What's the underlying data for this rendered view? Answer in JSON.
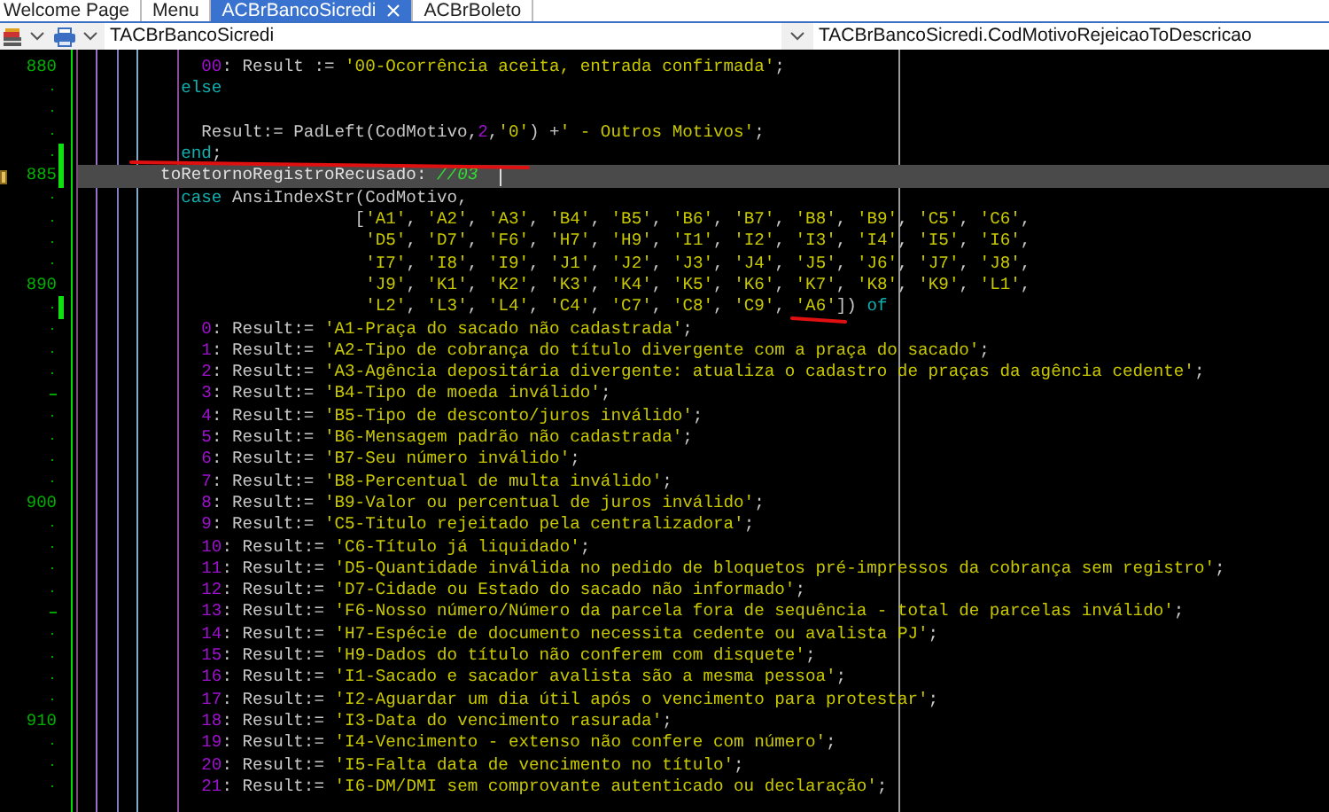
{
  "tabs": [
    {
      "label": "Welcome Page",
      "selected": false,
      "closable": false
    },
    {
      "label": "Menu",
      "selected": false,
      "closable": false
    },
    {
      "label": "ACBrBancoSicredi",
      "selected": true,
      "closable": true
    },
    {
      "label": "ACBrBoleto",
      "selected": false,
      "closable": false
    }
  ],
  "toolbar": {
    "class_combo": {
      "value": "TACBrBancoSicredi"
    },
    "method_combo": {
      "value": "TACBrBancoSicredi.CodMotivoRejeicaoToDescricao"
    }
  },
  "editor": {
    "lines": [
      {
        "number": "880",
        "modified": false,
        "current": false,
        "bookmark": false,
        "tokens": [
          {
            "kind": "num",
            "text": "      00"
          },
          {
            "kind": "id",
            "text": ": Result := "
          },
          {
            "kind": "str",
            "text": "'00-Ocorrência aceita, entrada confirmada'"
          },
          {
            "kind": "id",
            "text": ";"
          }
        ]
      },
      {
        "modified": false,
        "current": false,
        "bookmark": false,
        "tokens": [
          {
            "kind": "kw",
            "text": "    else"
          }
        ]
      },
      {
        "modified": false,
        "current": false,
        "bookmark": false
      },
      {
        "modified": false,
        "current": false,
        "bookmark": false,
        "tokens": [
          {
            "kind": "id",
            "text": "      Result:= PadLeft(CodMotivo,"
          },
          {
            "kind": "num",
            "text": "2"
          },
          {
            "kind": "id",
            "text": ","
          },
          {
            "kind": "str",
            "text": "'0'"
          },
          {
            "kind": "id",
            "text": ") +"
          },
          {
            "kind": "str",
            "text": "' - Outros Motivos'"
          },
          {
            "kind": "id",
            "text": ";"
          }
        ]
      },
      {
        "modified": true,
        "current": false,
        "bookmark": false,
        "tokens": [
          {
            "kind": "kw",
            "text": "    end"
          },
          {
            "kind": "id",
            "text": ";"
          }
        ]
      },
      {
        "number": "885",
        "modified": true,
        "current": true,
        "bookmark": true,
        "tokens": [
          {
            "kind": "id",
            "text": "  toRetornoRegistroRecusado: "
          },
          {
            "kind": "comment",
            "text": "//03"
          }
        ]
      },
      {
        "modified": false,
        "current": false,
        "bookmark": false,
        "tokens": [
          {
            "kind": "kw",
            "text": "    case"
          },
          {
            "kind": "id",
            "text": " AnsiIndexStr(CodMotivo,"
          }
        ]
      },
      {
        "modified": false,
        "current": false,
        "bookmark": false,
        "tokens": [
          {
            "kind": "id",
            "text": "                     ["
          },
          {
            "kind": "str",
            "text": "'A1'"
          },
          {
            "kind": "id",
            "text": ", "
          },
          {
            "kind": "str",
            "text": "'A2'"
          },
          {
            "kind": "id",
            "text": ", "
          },
          {
            "kind": "str",
            "text": "'A3'"
          },
          {
            "kind": "id",
            "text": ", "
          },
          {
            "kind": "str",
            "text": "'B4'"
          },
          {
            "kind": "id",
            "text": ", "
          },
          {
            "kind": "str",
            "text": "'B5'"
          },
          {
            "kind": "id",
            "text": ", "
          },
          {
            "kind": "str",
            "text": "'B6'"
          },
          {
            "kind": "id",
            "text": ", "
          },
          {
            "kind": "str",
            "text": "'B7'"
          },
          {
            "kind": "id",
            "text": ", "
          },
          {
            "kind": "str",
            "text": "'B8'"
          },
          {
            "kind": "id",
            "text": ", "
          },
          {
            "kind": "str",
            "text": "'B9'"
          },
          {
            "kind": "id",
            "text": ", "
          },
          {
            "kind": "str",
            "text": "'C5'"
          },
          {
            "kind": "id",
            "text": ", "
          },
          {
            "kind": "str",
            "text": "'C6'"
          },
          {
            "kind": "id",
            "text": ","
          }
        ]
      },
      {
        "modified": false,
        "current": false,
        "bookmark": false,
        "tokens": [
          {
            "kind": "str",
            "text": "                      'D5'"
          },
          {
            "kind": "id",
            "text": ", "
          },
          {
            "kind": "str",
            "text": "'D7'"
          },
          {
            "kind": "id",
            "text": ", "
          },
          {
            "kind": "str",
            "text": "'F6'"
          },
          {
            "kind": "id",
            "text": ", "
          },
          {
            "kind": "str",
            "text": "'H7'"
          },
          {
            "kind": "id",
            "text": ", "
          },
          {
            "kind": "str",
            "text": "'H9'"
          },
          {
            "kind": "id",
            "text": ", "
          },
          {
            "kind": "str",
            "text": "'I1'"
          },
          {
            "kind": "id",
            "text": ", "
          },
          {
            "kind": "str",
            "text": "'I2'"
          },
          {
            "kind": "id",
            "text": ", "
          },
          {
            "kind": "str",
            "text": "'I3'"
          },
          {
            "kind": "id",
            "text": ", "
          },
          {
            "kind": "str",
            "text": "'I4'"
          },
          {
            "kind": "id",
            "text": ", "
          },
          {
            "kind": "str",
            "text": "'I5'"
          },
          {
            "kind": "id",
            "text": ", "
          },
          {
            "kind": "str",
            "text": "'I6'"
          },
          {
            "kind": "id",
            "text": ","
          }
        ]
      },
      {
        "modified": false,
        "current": false,
        "bookmark": false,
        "tokens": [
          {
            "kind": "str",
            "text": "                      'I7'"
          },
          {
            "kind": "id",
            "text": ", "
          },
          {
            "kind": "str",
            "text": "'I8'"
          },
          {
            "kind": "id",
            "text": ", "
          },
          {
            "kind": "str",
            "text": "'I9'"
          },
          {
            "kind": "id",
            "text": ", "
          },
          {
            "kind": "str",
            "text": "'J1'"
          },
          {
            "kind": "id",
            "text": ", "
          },
          {
            "kind": "str",
            "text": "'J2'"
          },
          {
            "kind": "id",
            "text": ", "
          },
          {
            "kind": "str",
            "text": "'J3'"
          },
          {
            "kind": "id",
            "text": ", "
          },
          {
            "kind": "str",
            "text": "'J4'"
          },
          {
            "kind": "id",
            "text": ", "
          },
          {
            "kind": "str",
            "text": "'J5'"
          },
          {
            "kind": "id",
            "text": ", "
          },
          {
            "kind": "str",
            "text": "'J6'"
          },
          {
            "kind": "id",
            "text": ", "
          },
          {
            "kind": "str",
            "text": "'J7'"
          },
          {
            "kind": "id",
            "text": ", "
          },
          {
            "kind": "str",
            "text": "'J8'"
          },
          {
            "kind": "id",
            "text": ","
          }
        ]
      },
      {
        "number": "890",
        "modified": false,
        "current": false,
        "bookmark": false,
        "tokens": [
          {
            "kind": "str",
            "text": "                      'J9'"
          },
          {
            "kind": "id",
            "text": ", "
          },
          {
            "kind": "str",
            "text": "'K1'"
          },
          {
            "kind": "id",
            "text": ", "
          },
          {
            "kind": "str",
            "text": "'K2'"
          },
          {
            "kind": "id",
            "text": ", "
          },
          {
            "kind": "str",
            "text": "'K3'"
          },
          {
            "kind": "id",
            "text": ", "
          },
          {
            "kind": "str",
            "text": "'K4'"
          },
          {
            "kind": "id",
            "text": ", "
          },
          {
            "kind": "str",
            "text": "'K5'"
          },
          {
            "kind": "id",
            "text": ", "
          },
          {
            "kind": "str",
            "text": "'K6'"
          },
          {
            "kind": "id",
            "text": ", "
          },
          {
            "kind": "str",
            "text": "'K7'"
          },
          {
            "kind": "id",
            "text": ", "
          },
          {
            "kind": "str",
            "text": "'K8'"
          },
          {
            "kind": "id",
            "text": ", "
          },
          {
            "kind": "str",
            "text": "'K9'"
          },
          {
            "kind": "id",
            "text": ", "
          },
          {
            "kind": "str",
            "text": "'L1'"
          },
          {
            "kind": "id",
            "text": ","
          }
        ]
      },
      {
        "modified": true,
        "current": false,
        "bookmark": false,
        "tokens": [
          {
            "kind": "str",
            "text": "                      'L2'"
          },
          {
            "kind": "id",
            "text": ", "
          },
          {
            "kind": "str",
            "text": "'L3'"
          },
          {
            "kind": "id",
            "text": ", "
          },
          {
            "kind": "str",
            "text": "'L4'"
          },
          {
            "kind": "id",
            "text": ", "
          },
          {
            "kind": "str",
            "text": "'C4'"
          },
          {
            "kind": "id",
            "text": ", "
          },
          {
            "kind": "str",
            "text": "'C7'"
          },
          {
            "kind": "id",
            "text": ", "
          },
          {
            "kind": "str",
            "text": "'C8'"
          },
          {
            "kind": "id",
            "text": ", "
          },
          {
            "kind": "str",
            "text": "'C9'"
          },
          {
            "kind": "id",
            "text": ", "
          },
          {
            "kind": "str",
            "text": "'A6'"
          },
          {
            "kind": "id",
            "text": "])"
          },
          {
            "kind": "kw",
            "text": " of"
          }
        ]
      },
      {
        "modified": false,
        "current": false,
        "bookmark": false,
        "tokens": [
          {
            "kind": "num",
            "text": "      0"
          },
          {
            "kind": "id",
            "text": ": Result:= "
          },
          {
            "kind": "str",
            "text": "'A1-Praça do sacado não cadastrada'"
          },
          {
            "kind": "id",
            "text": ";"
          }
        ]
      },
      {
        "modified": false,
        "current": false,
        "bookmark": false,
        "tokens": [
          {
            "kind": "num",
            "text": "      1"
          },
          {
            "kind": "id",
            "text": ": Result:= "
          },
          {
            "kind": "str",
            "text": "'A2-Tipo de cobrança do título divergente com a praça do sacado'"
          },
          {
            "kind": "id",
            "text": ";"
          }
        ]
      },
      {
        "modified": false,
        "current": false,
        "bookmark": false,
        "tokens": [
          {
            "kind": "num",
            "text": "      2"
          },
          {
            "kind": "id",
            "text": ": Result:= "
          },
          {
            "kind": "str",
            "text": "'A3-Agência depositária divergente: atualiza o cadastro de praças da agência cedente'"
          },
          {
            "kind": "id",
            "text": ";"
          }
        ]
      },
      {
        "modified": false,
        "current": false,
        "bookmark": false,
        "tokens": [
          {
            "kind": "num",
            "text": "      3"
          },
          {
            "kind": "id",
            "text": ": Result:= "
          },
          {
            "kind": "str",
            "text": "'B4-Tipo de moeda inválido'"
          },
          {
            "kind": "id",
            "text": ";"
          }
        ]
      },
      {
        "modified": false,
        "current": false,
        "bookmark": false,
        "tokens": [
          {
            "kind": "num",
            "text": "      4"
          },
          {
            "kind": "id",
            "text": ": Result:= "
          },
          {
            "kind": "str",
            "text": "'B5-Tipo de desconto/juros inválido'"
          },
          {
            "kind": "id",
            "text": ";"
          }
        ]
      },
      {
        "modified": false,
        "current": false,
        "bookmark": false,
        "tokens": [
          {
            "kind": "num",
            "text": "      5"
          },
          {
            "kind": "id",
            "text": ": Result:= "
          },
          {
            "kind": "str",
            "text": "'B6-Mensagem padrão não cadastrada'"
          },
          {
            "kind": "id",
            "text": ";"
          }
        ]
      },
      {
        "modified": false,
        "current": false,
        "bookmark": false,
        "tokens": [
          {
            "kind": "num",
            "text": "      6"
          },
          {
            "kind": "id",
            "text": ": Result:= "
          },
          {
            "kind": "str",
            "text": "'B7-Seu número inválido'"
          },
          {
            "kind": "id",
            "text": ";"
          }
        ]
      },
      {
        "modified": false,
        "current": false,
        "bookmark": false,
        "tokens": [
          {
            "kind": "num",
            "text": "      7"
          },
          {
            "kind": "id",
            "text": ": Result:= "
          },
          {
            "kind": "str",
            "text": "'B8-Percentual de multa inválido'"
          },
          {
            "kind": "id",
            "text": ";"
          }
        ]
      },
      {
        "number": "900",
        "modified": false,
        "current": false,
        "bookmark": false,
        "tokens": [
          {
            "kind": "num",
            "text": "      8"
          },
          {
            "kind": "id",
            "text": ": Result:= "
          },
          {
            "kind": "str",
            "text": "'B9-Valor ou percentual de juros inválido'"
          },
          {
            "kind": "id",
            "text": ";"
          }
        ]
      },
      {
        "modified": false,
        "current": false,
        "bookmark": false,
        "tokens": [
          {
            "kind": "num",
            "text": "      9"
          },
          {
            "kind": "id",
            "text": ": Result:= "
          },
          {
            "kind": "str",
            "text": "'C5-Titulo rejeitado pela centralizadora'"
          },
          {
            "kind": "id",
            "text": ";"
          }
        ]
      },
      {
        "modified": false,
        "current": false,
        "bookmark": false,
        "tokens": [
          {
            "kind": "num",
            "text": "      10"
          },
          {
            "kind": "id",
            "text": ": Result:= "
          },
          {
            "kind": "str",
            "text": "'C6-Título já liquidado'"
          },
          {
            "kind": "id",
            "text": ";"
          }
        ]
      },
      {
        "modified": false,
        "current": false,
        "bookmark": false,
        "tokens": [
          {
            "kind": "num",
            "text": "      11"
          },
          {
            "kind": "id",
            "text": ": Result:= "
          },
          {
            "kind": "str",
            "text": "'D5-Quantidade inválida no pedido de bloquetos pré-impressos da cobrança sem registro'"
          },
          {
            "kind": "id",
            "text": ";"
          }
        ]
      },
      {
        "modified": false,
        "current": false,
        "bookmark": false,
        "tokens": [
          {
            "kind": "num",
            "text": "      12"
          },
          {
            "kind": "id",
            "text": ": Result:= "
          },
          {
            "kind": "str",
            "text": "'D7-Cidade ou Estado do sacado não informado'"
          },
          {
            "kind": "id",
            "text": ";"
          }
        ]
      },
      {
        "modified": false,
        "current": false,
        "bookmark": false,
        "tokens": [
          {
            "kind": "num",
            "text": "      13"
          },
          {
            "kind": "id",
            "text": ": Result:= "
          },
          {
            "kind": "str",
            "text": "'F6-Nosso número/Número da parcela fora de sequência - total de parcelas inválido'"
          },
          {
            "kind": "id",
            "text": ";"
          }
        ]
      },
      {
        "modified": false,
        "current": false,
        "bookmark": false,
        "tokens": [
          {
            "kind": "num",
            "text": "      14"
          },
          {
            "kind": "id",
            "text": ": Result:= "
          },
          {
            "kind": "str",
            "text": "'H7-Espécie de documento necessita cedente ou avalista PJ'"
          },
          {
            "kind": "id",
            "text": ";"
          }
        ]
      },
      {
        "modified": false,
        "current": false,
        "bookmark": false,
        "tokens": [
          {
            "kind": "num",
            "text": "      15"
          },
          {
            "kind": "id",
            "text": ": Result:= "
          },
          {
            "kind": "str",
            "text": "'H9-Dados do título não conferem com disquete'"
          },
          {
            "kind": "id",
            "text": ";"
          }
        ]
      },
      {
        "modified": false,
        "current": false,
        "bookmark": false,
        "tokens": [
          {
            "kind": "num",
            "text": "      16"
          },
          {
            "kind": "id",
            "text": ": Result:= "
          },
          {
            "kind": "str",
            "text": "'I1-Sacado e sacador avalista são a mesma pessoa'"
          },
          {
            "kind": "id",
            "text": ";"
          }
        ]
      },
      {
        "modified": false,
        "current": false,
        "bookmark": false,
        "tokens": [
          {
            "kind": "num",
            "text": "      17"
          },
          {
            "kind": "id",
            "text": ": Result:= "
          },
          {
            "kind": "str",
            "text": "'I2-Aguardar um dia útil após o vencimento para protestar'"
          },
          {
            "kind": "id",
            "text": ";"
          }
        ]
      },
      {
        "number": "910",
        "modified": false,
        "current": false,
        "bookmark": false,
        "tokens": [
          {
            "kind": "num",
            "text": "      18"
          },
          {
            "kind": "id",
            "text": ": Result:= "
          },
          {
            "kind": "str",
            "text": "'I3-Data do vencimento rasurada'"
          },
          {
            "kind": "id",
            "text": ";"
          }
        ]
      },
      {
        "modified": false,
        "current": false,
        "bookmark": false,
        "tokens": [
          {
            "kind": "num",
            "text": "      19"
          },
          {
            "kind": "id",
            "text": ": Result:= "
          },
          {
            "kind": "str",
            "text": "'I4-Vencimento - extenso não confere com número'"
          },
          {
            "kind": "id",
            "text": ";"
          }
        ]
      },
      {
        "modified": false,
        "current": false,
        "bookmark": false,
        "tokens": [
          {
            "kind": "num",
            "text": "      20"
          },
          {
            "kind": "id",
            "text": ": Result:= "
          },
          {
            "kind": "str",
            "text": "'I5-Falta data de vencimento no título'"
          },
          {
            "kind": "id",
            "text": ";"
          }
        ]
      },
      {
        "modified": false,
        "current": false,
        "bookmark": false,
        "tokens": [
          {
            "kind": "num",
            "text": "      21"
          },
          {
            "kind": "id",
            "text": ": Result:= "
          },
          {
            "kind": "str",
            "text": "'I6-DM/DMI sem comprovante autenticado ou declaração'"
          },
          {
            "kind": "id",
            "text": ";"
          }
        ]
      }
    ]
  }
}
